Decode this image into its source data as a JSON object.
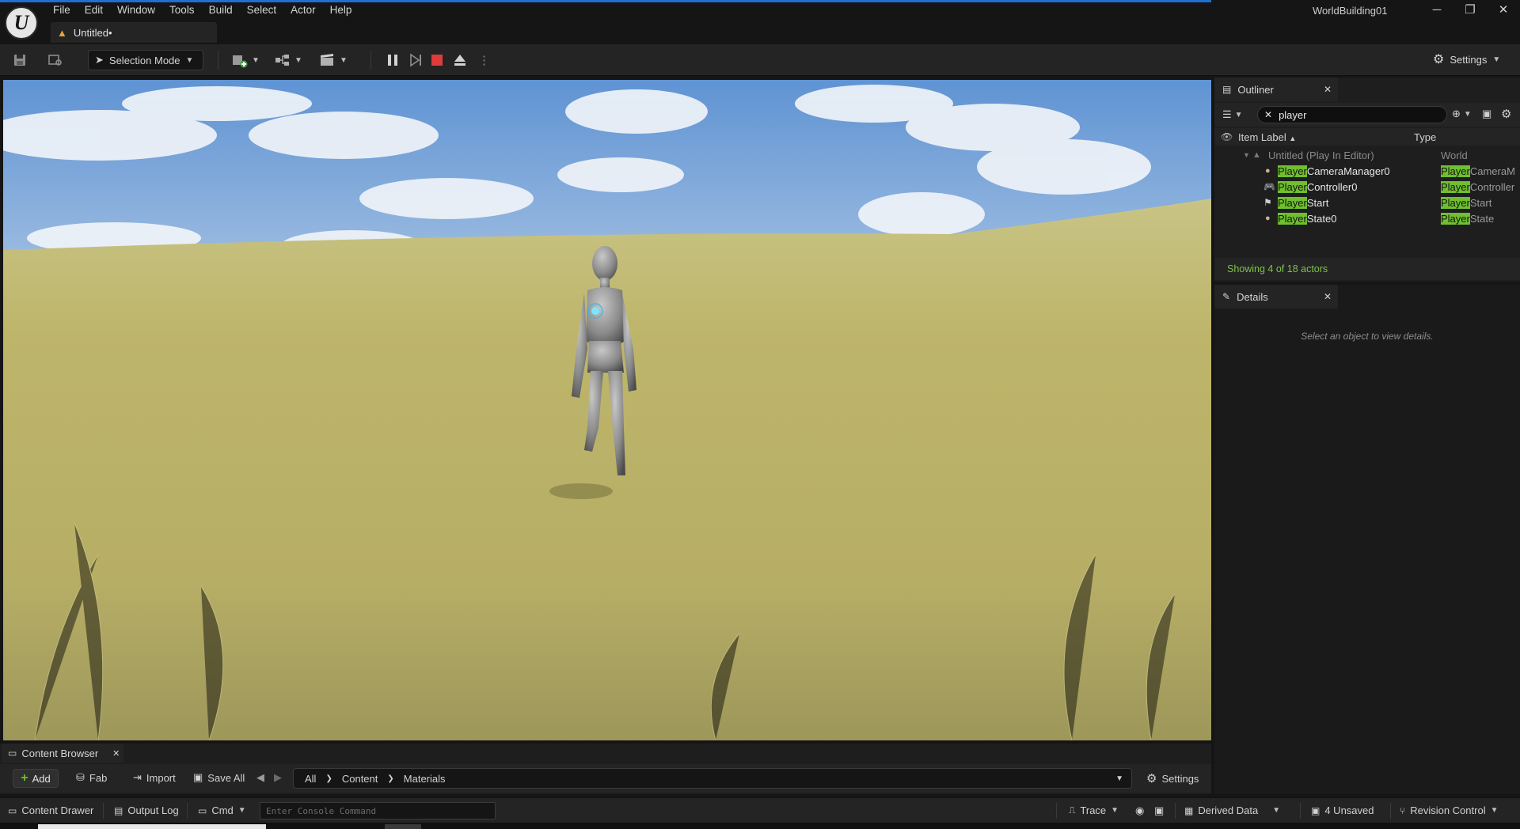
{
  "window": {
    "project_name": "WorldBuilding01",
    "document_tab": "Untitled•"
  },
  "menu": [
    "File",
    "Edit",
    "Window",
    "Tools",
    "Build",
    "Select",
    "Actor",
    "Help"
  ],
  "toolbar": {
    "selection_mode": "Selection Mode",
    "settings": "Settings"
  },
  "outliner": {
    "tab_label": "Outliner",
    "search_value": "player",
    "col_label": "Item Label",
    "col_type": "Type",
    "world_row": {
      "label": "Untitled (Play In Editor)",
      "type": "World"
    },
    "rows": [
      {
        "highlight": "Player",
        "name_rest": "CameraManager0",
        "type_highlight": "Player",
        "type_rest": "CameraM"
      },
      {
        "highlight": "Player",
        "name_rest": "Controller0",
        "type_highlight": "Player",
        "type_rest": "Controller"
      },
      {
        "highlight": "Player",
        "name_rest": "Start",
        "type_highlight": "Player",
        "type_rest": "Start"
      },
      {
        "highlight": "Player",
        "name_rest": "State0",
        "type_highlight": "Player",
        "type_rest": "State"
      }
    ],
    "status": "Showing 4 of 18 actors"
  },
  "details": {
    "tab_label": "Details",
    "empty_message": "Select an object to view details."
  },
  "content_browser": {
    "tab_label": "Content Browser",
    "add": "Add",
    "fab": "Fab",
    "import": "Import",
    "save_all": "Save All",
    "path": [
      "All",
      "Content",
      "Materials"
    ],
    "settings": "Settings"
  },
  "statusbar": {
    "content_drawer": "Content Drawer",
    "output_log": "Output Log",
    "cmd": "Cmd",
    "console_placeholder": "Enter Console Command",
    "trace": "Trace",
    "derived_data": "Derived Data",
    "unsaved": "4 Unsaved",
    "revision_control": "Revision Control"
  },
  "colors": {
    "accent_blue": "#1f6fd0",
    "search_highlight": "#6fbf2f",
    "status_green": "#7fc24a",
    "stop_red": "#e03b3b"
  }
}
